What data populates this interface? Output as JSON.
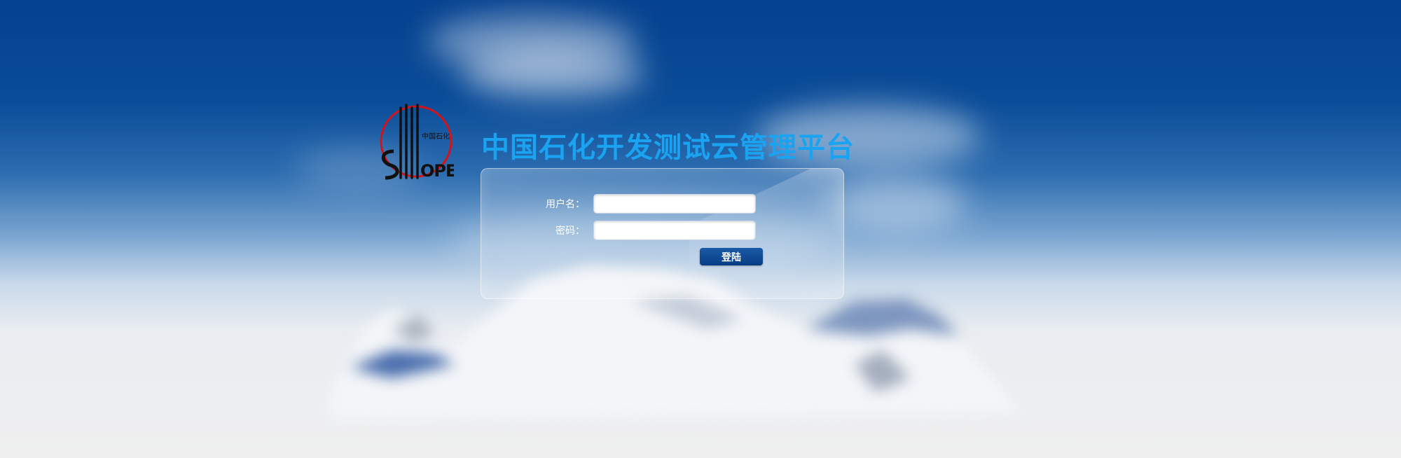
{
  "logo": {
    "emblem_text": "中国石化",
    "brand_text": "SINOPEC",
    "ring_color": "#d0141c"
  },
  "page": {
    "title": "中国石化开发测试云管理平台"
  },
  "login_form": {
    "username_label": "用户名：",
    "username_value": "",
    "password_label": "密码：",
    "password_value": "",
    "submit_label": "登陆"
  },
  "colors": {
    "title": "#1aa3f0",
    "button": "#073c84",
    "sky_top": "#04418f"
  }
}
